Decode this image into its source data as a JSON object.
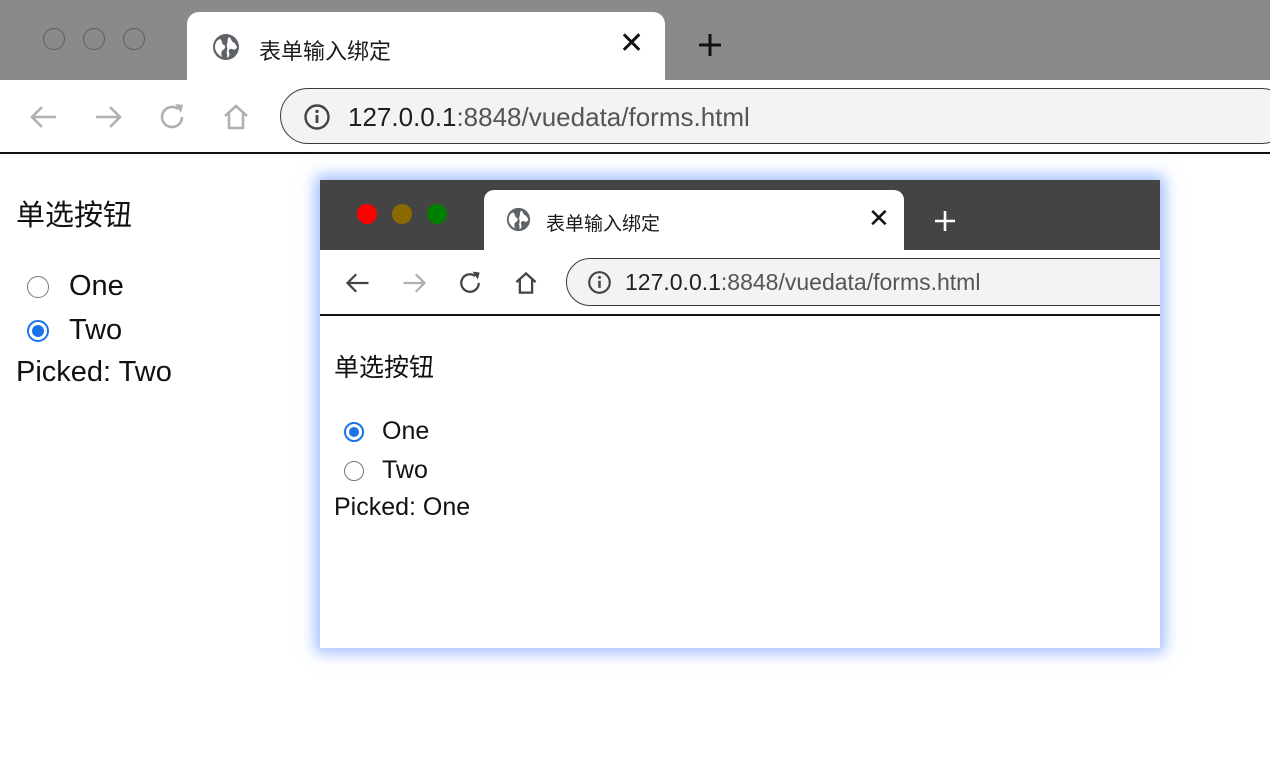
{
  "browser": {
    "tab_title": "表单输入绑定",
    "tab_icon": "globe-icon",
    "close_icon": "close-icon",
    "new_tab_icon": "plus-icon",
    "url_host": "127.0.0.1",
    "url_rest": ":8848/vuedata/forms.html",
    "nav_icons": [
      "back-arrow-icon",
      "forward-arrow-icon",
      "reload-icon",
      "home-icon"
    ]
  },
  "page": {
    "heading": "单选按钮",
    "options": [
      {
        "label": "One",
        "checked": false
      },
      {
        "label": "Two",
        "checked": true
      }
    ],
    "picked_text": "Picked: Two"
  },
  "inner_window": {
    "tab_title": "表单输入绑定",
    "url_host": "127.0.0.1",
    "url_rest": ":8848/vuedata/forms.html",
    "traffic_colors": [
      "#ff0000",
      "#8a6a00",
      "#008000"
    ],
    "heading": "单选按钮",
    "options": [
      {
        "label": "One",
        "checked": true
      },
      {
        "label": "Two",
        "checked": false
      }
    ],
    "picked_text": "Picked: One"
  },
  "colors": {
    "accent": "#1a73e8",
    "tabstrip": "#8a8a8a",
    "inner_tabstrip": "#444444",
    "inner_glow": "#5a8cff"
  }
}
